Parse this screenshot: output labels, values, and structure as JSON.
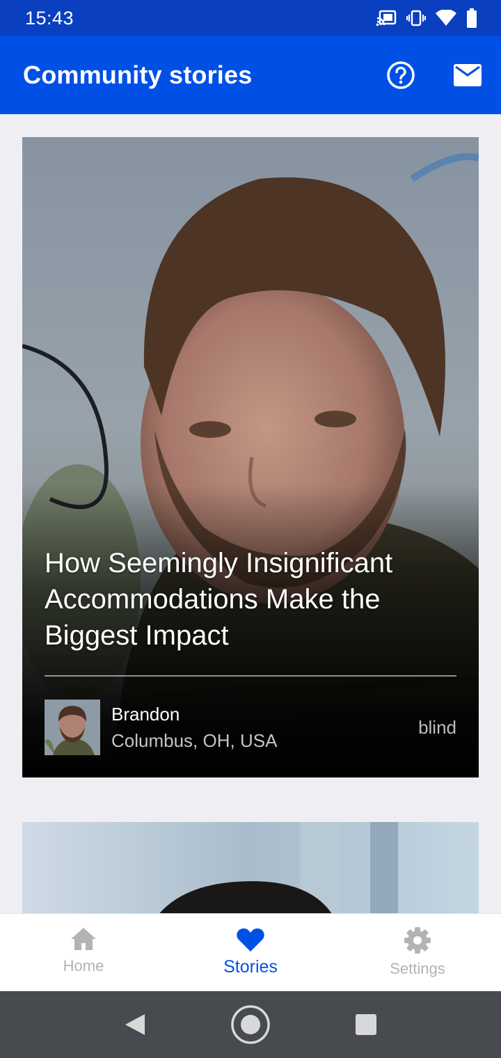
{
  "status_bar": {
    "time": "15:43",
    "icons": [
      "cast-icon",
      "vibrate-icon",
      "wifi-icon",
      "battery-icon"
    ]
  },
  "app_bar": {
    "title": "Community stories",
    "actions": [
      "help-icon",
      "mail-icon"
    ],
    "color": "#0050e6"
  },
  "stories": [
    {
      "title": "How Seemingly Insignificant Accommodations Make the Biggest Impact",
      "author_name": "Brandon",
      "author_location": "Columbus, OH, USA",
      "tag": "blind"
    }
  ],
  "bottom_nav": {
    "items": [
      {
        "label": "Home",
        "icon": "home-icon",
        "active": false
      },
      {
        "label": "Stories",
        "icon": "heart-icon",
        "active": true
      },
      {
        "label": "Settings",
        "icon": "gear-icon",
        "active": false
      }
    ],
    "active_color": "#0050e6",
    "inactive_color": "#b3b3b3"
  },
  "system_nav": [
    "back-icon",
    "home-circle-icon",
    "recents-icon"
  ]
}
